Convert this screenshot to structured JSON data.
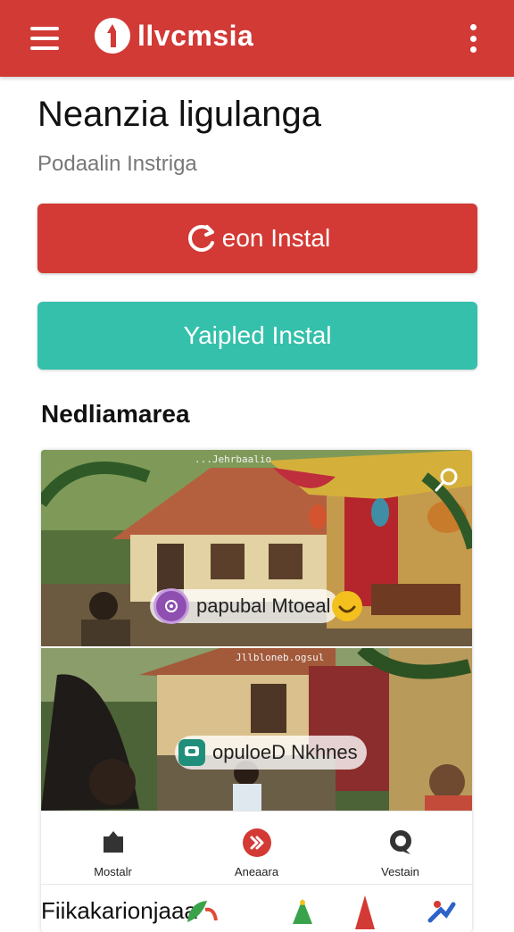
{
  "app_bar": {
    "title": "llvcmsia",
    "background": "#d23a36",
    "icons": {
      "menu": "hamburger-icon",
      "logo": "app-logo-icon",
      "more": "more-vertical-icon"
    }
  },
  "header": {
    "title": "Neanzia ligulanga",
    "subtitle": "Podaalin Instriga"
  },
  "buttons": {
    "primary": {
      "label": "eon Instal",
      "icon": "refresh-icon",
      "color": "#d33a35"
    },
    "secondary": {
      "label": "Yaipled Instal",
      "color": "#34c0ab"
    }
  },
  "section": {
    "title": "Nedliamarea"
  },
  "card": {
    "media": [
      {
        "caption": "...Jehrbaalio",
        "chip_label": "papubal Mtoeal",
        "chip_icon": "eye-icon",
        "action_icon": "smile-icon",
        "search_icon": "search-icon"
      },
      {
        "caption": "Jllbloneb.ogsul",
        "chip_label": "opuloeD Nkhnes",
        "chip_icon": "chat-icon"
      }
    ],
    "nav": [
      {
        "label": "Mostalr",
        "icon": "shield-icon"
      },
      {
        "label": "Aneaara",
        "icon": "forward-icon"
      },
      {
        "label": "Vestain",
        "icon": "chat-bubble-icon"
      }
    ],
    "footer_text": "Fiikakarionjaaa"
  }
}
